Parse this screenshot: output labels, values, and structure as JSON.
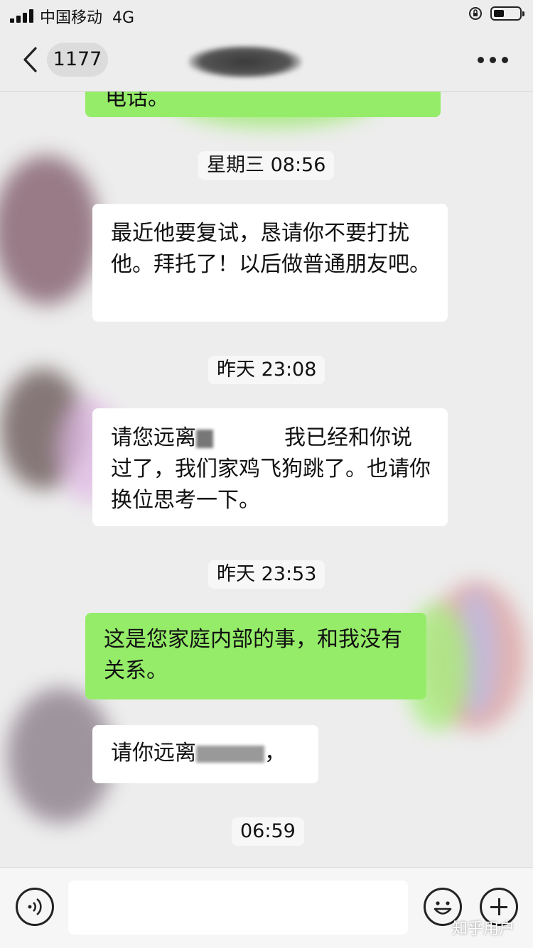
{
  "status_bar": {
    "carrier": "中国移动",
    "network": "4G",
    "battery_level": 0.4
  },
  "nav": {
    "unread_count": "1177"
  },
  "messages": [
    {
      "type": "out",
      "text": "电话。"
    },
    {
      "type": "time",
      "text": "星期三 08:56"
    },
    {
      "type": "in",
      "text": "最近他要复试，恳请你不要打扰他。拜托了！以后做普通朋友吧。"
    },
    {
      "type": "time",
      "text": "昨天 23:08"
    },
    {
      "type": "in",
      "text_before": "请您远离",
      "text_after": "我已经和你说过了，我们家鸡飞狗跳了。也请你换位思考一下。"
    },
    {
      "type": "time",
      "text": "昨天 23:53"
    },
    {
      "type": "out",
      "text": "这是您家庭内部的事，和我没有关系。"
    },
    {
      "type": "in",
      "text_before": "请你远离",
      "text_after": "，"
    },
    {
      "type": "time",
      "text": "06:59"
    }
  ],
  "input": {
    "placeholder": ""
  },
  "watermark": "知乎用户",
  "colors": {
    "outgoing": "#95ec69",
    "incoming": "#ffffff",
    "background": "#ededed"
  }
}
